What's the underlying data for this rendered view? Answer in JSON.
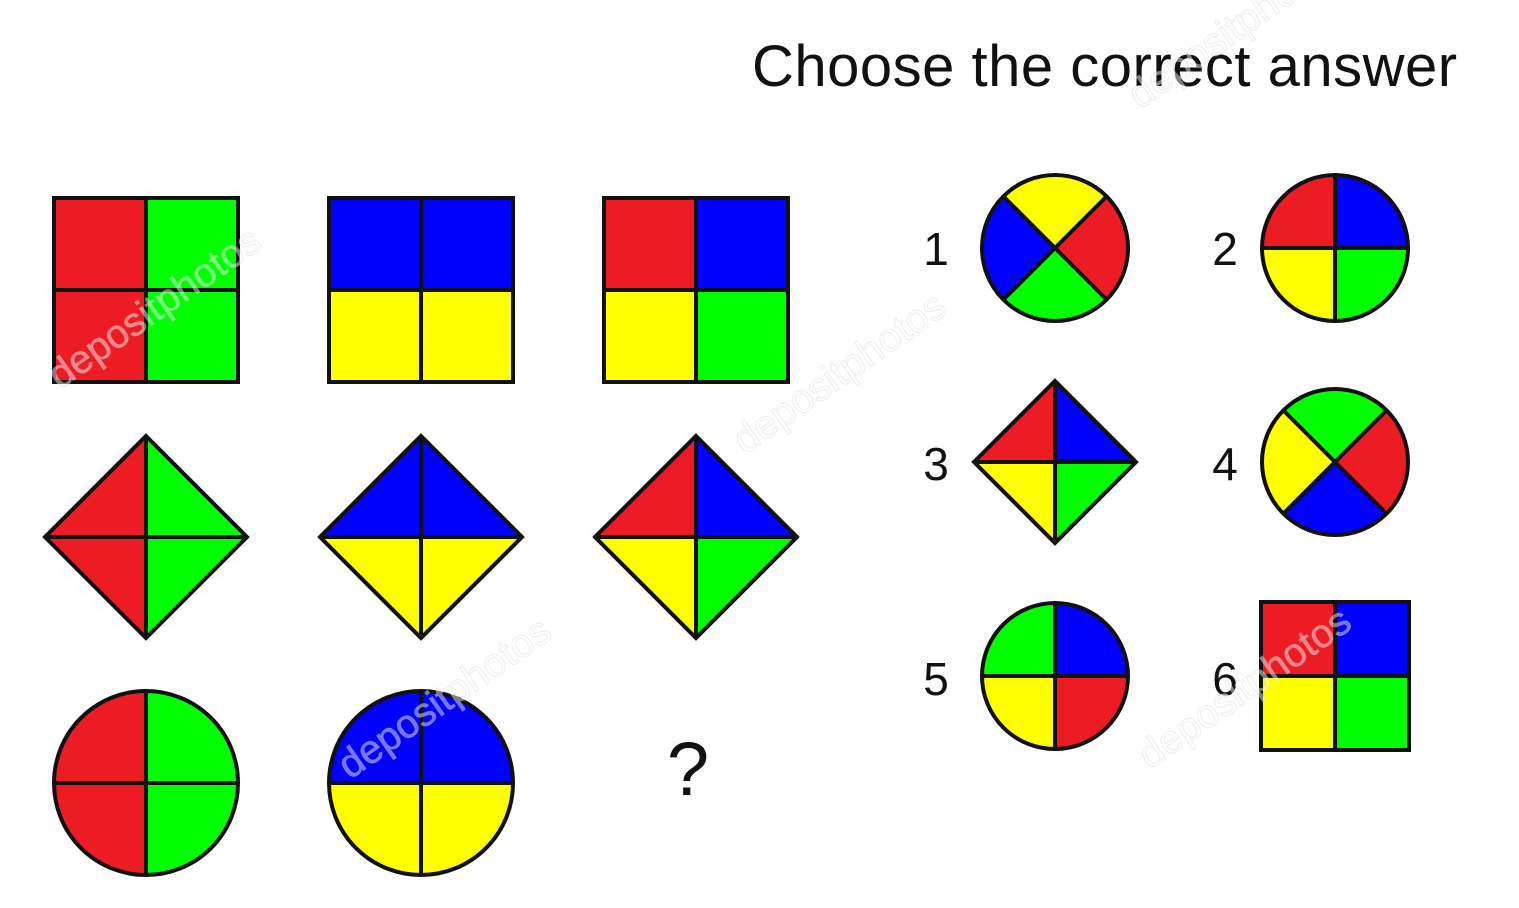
{
  "title": "Choose the correct answer",
  "question_mark": "?",
  "colors": {
    "red": "#ed1c24",
    "green": "#00ff00",
    "blue": "#0000ff",
    "yellow": "#ffff00",
    "outline": "#111111"
  },
  "watermark": "depositphotos",
  "grid": [
    {
      "row": 1,
      "col": 1,
      "shape": "square",
      "orientation": "vertical-split",
      "quadrants": [
        "red",
        "green",
        "red",
        "green"
      ]
    },
    {
      "row": 1,
      "col": 2,
      "shape": "square",
      "orientation": "horizontal-split",
      "quadrants": [
        "blue",
        "blue",
        "yellow",
        "yellow"
      ]
    },
    {
      "row": 1,
      "col": 3,
      "shape": "square",
      "orientation": "mixed",
      "quadrants": [
        "red",
        "blue",
        "yellow",
        "green"
      ]
    },
    {
      "row": 2,
      "col": 1,
      "shape": "diamond",
      "orientation": "vertical-split",
      "quadrants": [
        "red",
        "green",
        "red",
        "green"
      ]
    },
    {
      "row": 2,
      "col": 2,
      "shape": "diamond",
      "orientation": "horizontal-split",
      "quadrants": [
        "blue",
        "blue",
        "yellow",
        "yellow"
      ]
    },
    {
      "row": 2,
      "col": 3,
      "shape": "diamond",
      "orientation": "mixed",
      "quadrants": [
        "red",
        "blue",
        "yellow",
        "green"
      ]
    },
    {
      "row": 3,
      "col": 1,
      "shape": "circle",
      "orientation": "vertical-split",
      "quadrants": [
        "red",
        "green",
        "red",
        "green"
      ]
    },
    {
      "row": 3,
      "col": 2,
      "shape": "circle",
      "orientation": "horizontal-split",
      "quadrants": [
        "blue",
        "blue",
        "yellow",
        "yellow"
      ]
    }
  ],
  "options": [
    {
      "number": "1",
      "shape": "circle-x",
      "quadrants": {
        "top": "yellow",
        "right": "red",
        "bottom": "green",
        "left": "blue"
      }
    },
    {
      "number": "2",
      "shape": "circle",
      "quadrants": [
        "red",
        "blue",
        "yellow",
        "green"
      ]
    },
    {
      "number": "3",
      "shape": "diamond",
      "quadrants": [
        "red",
        "blue",
        "yellow",
        "green"
      ]
    },
    {
      "number": "4",
      "shape": "circle-x",
      "quadrants": {
        "top": "green",
        "right": "red",
        "bottom": "blue",
        "left": "yellow"
      }
    },
    {
      "number": "5",
      "shape": "circle",
      "quadrants": [
        "green",
        "blue",
        "yellow",
        "red"
      ]
    },
    {
      "number": "6",
      "shape": "square",
      "quadrants": [
        "red",
        "blue",
        "yellow",
        "green"
      ]
    }
  ]
}
